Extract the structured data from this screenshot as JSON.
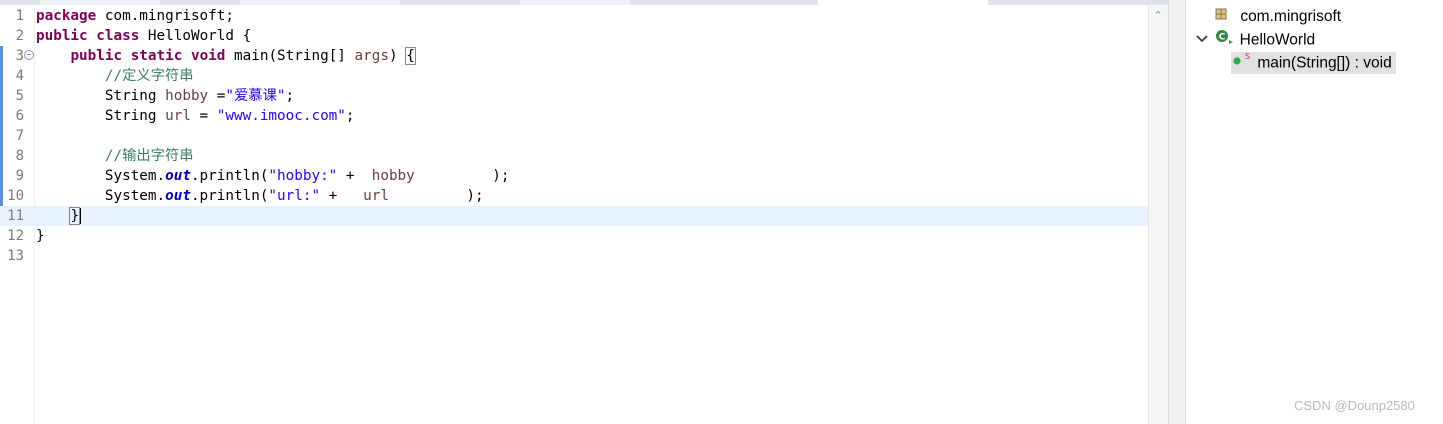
{
  "editor": {
    "lines": [
      {
        "num": "1",
        "tokens": [
          {
            "t": "kw",
            "v": "package"
          },
          {
            "t": "",
            "v": " com.mingrisoft;"
          }
        ]
      },
      {
        "num": "2",
        "tokens": [
          {
            "t": "kw",
            "v": "public"
          },
          {
            "t": "",
            "v": " "
          },
          {
            "t": "kw",
            "v": "class"
          },
          {
            "t": "",
            "v": " HelloWorld {"
          }
        ]
      },
      {
        "num": "3",
        "fold": "−",
        "tokens": [
          {
            "t": "",
            "v": "    "
          },
          {
            "t": "kw",
            "v": "public"
          },
          {
            "t": "",
            "v": " "
          },
          {
            "t": "kw",
            "v": "static"
          },
          {
            "t": "",
            "v": " "
          },
          {
            "t": "kw",
            "v": "void"
          },
          {
            "t": "",
            "v": " main(String[] "
          },
          {
            "t": "var",
            "v": "args"
          },
          {
            "t": "",
            "v": ") "
          },
          {
            "t": "brk",
            "v": "{"
          }
        ]
      },
      {
        "num": "4",
        "tokens": [
          {
            "t": "",
            "v": "        "
          },
          {
            "t": "cm",
            "v": "//定义字符串"
          }
        ]
      },
      {
        "num": "5",
        "tokens": [
          {
            "t": "",
            "v": "        String "
          },
          {
            "t": "var",
            "v": "hobby"
          },
          {
            "t": "",
            "v": " ="
          },
          {
            "t": "str",
            "v": "\"爱慕课\""
          },
          {
            "t": "",
            "v": ";"
          }
        ]
      },
      {
        "num": "6",
        "tokens": [
          {
            "t": "",
            "v": "        String "
          },
          {
            "t": "var",
            "v": "url"
          },
          {
            "t": "",
            "v": " = "
          },
          {
            "t": "str",
            "v": "\"www.imooc.com\""
          },
          {
            "t": "",
            "v": ";"
          }
        ]
      },
      {
        "num": "7",
        "tokens": []
      },
      {
        "num": "8",
        "tokens": [
          {
            "t": "",
            "v": "        "
          },
          {
            "t": "cm",
            "v": "//输出字符串"
          }
        ]
      },
      {
        "num": "9",
        "tokens": [
          {
            "t": "",
            "v": "        System."
          },
          {
            "t": "fld",
            "v": "out"
          },
          {
            "t": "",
            "v": ".println("
          },
          {
            "t": "str",
            "v": "\"hobby:\""
          },
          {
            "t": "",
            "v": " +  "
          },
          {
            "t": "var",
            "v": "hobby"
          },
          {
            "t": "",
            "v": "         );"
          }
        ]
      },
      {
        "num": "10",
        "tokens": [
          {
            "t": "",
            "v": "        System."
          },
          {
            "t": "fld",
            "v": "out"
          },
          {
            "t": "",
            "v": ".println("
          },
          {
            "t": "str",
            "v": "\"url:\""
          },
          {
            "t": "",
            "v": " +   "
          },
          {
            "t": "var",
            "v": "url"
          },
          {
            "t": "",
            "v": "         );"
          }
        ]
      },
      {
        "num": "11",
        "current": true,
        "tokens": [
          {
            "t": "",
            "v": "    "
          },
          {
            "t": "brk",
            "v": "}"
          },
          {
            "t": "caret",
            "v": ""
          }
        ]
      },
      {
        "num": "12",
        "tokens": [
          {
            "t": "",
            "v": "}"
          }
        ]
      },
      {
        "num": "13",
        "tokens": []
      }
    ]
  },
  "outline": {
    "package": "com.mingrisoft",
    "class_name": "HelloWorld",
    "method": "main(String[]) : void",
    "method_modifier": "S",
    "package_icon": "package-icon",
    "class_icon": "class-icon",
    "method_icon": "public-method-icon",
    "expand_icon": "chevron-down-icon",
    "colors": {
      "class_icon": "#2e8b3e",
      "method_icon": "#34a853",
      "modifier": "#c1352c"
    }
  },
  "watermark": "CSDN @Dounp2580"
}
